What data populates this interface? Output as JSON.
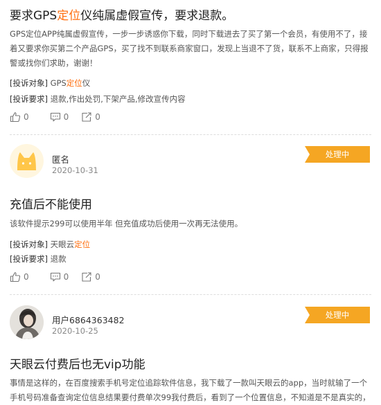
{
  "colors": {
    "accent": "#ff6f0f",
    "badge": "#f5a623",
    "divider": "#dddddd"
  },
  "complaints": [
    {
      "title_pre": "要求GPS",
      "title_hl": "定位",
      "title_post": "仪纯属虚假宣传，要求退款。",
      "body": "GPS定位APP纯属虚假宣传，一步一步诱惑你下载，同时下载进去了买了第一个会员，有使用不了，接着又要求你买第二个产品GPS，买了找不到联系商家窗口，发现上当退不了货，联系不上商家，只得报警或找你们求助，谢谢！",
      "target_label": "[投诉对象]",
      "target_pre": "GPS",
      "target_hl": "定位",
      "target_post": "仪",
      "request_label": "[投诉要求]",
      "request": "退款,作出处罚,下架产品,修改宣传内容",
      "likes": "0",
      "comments": "0",
      "shares": "0"
    },
    {
      "user": "匿名",
      "date": "2020-10-31",
      "status": "处理中",
      "avatar_icon": "cat-avatar-icon",
      "title": "充值后不能使用",
      "body": "该软件提示299可以使用半年 但充值成功后使用一次再无法使用。",
      "target_label": "[投诉对象]",
      "target_pre": "天眼云",
      "target_hl": "定位",
      "request_label": "[投诉要求]",
      "request": "退款",
      "likes": "0",
      "comments": "0",
      "shares": "0"
    },
    {
      "user": "用户6864363482",
      "date": "2020-10-25",
      "status": "处理中",
      "avatar_icon": "user-photo-avatar",
      "title": "天眼云付费后也无vip功能",
      "body": "事情是这样的，在百度搜索手机号定位追踪软件信息，我下载了一款叫天眼云的app，当时就输了一个手机号码准备查询定位信息结果要付费单次99我付费后，看到了一个位置信息，不知道是不是真实的，"
    }
  ]
}
